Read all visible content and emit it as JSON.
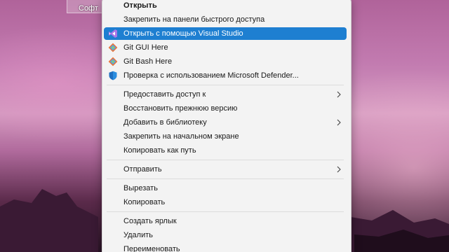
{
  "desktop": {
    "label": "Софт"
  },
  "menu": {
    "groups": [
      {
        "items": [
          {
            "label": "Открыть",
            "bold": true
          },
          {
            "label": "Закрепить на панели быстрого доступа"
          },
          {
            "label": "Открыть с помощью Visual Studio",
            "icon": "visual-studio-icon",
            "highlighted": true
          },
          {
            "label": "Git GUI Here",
            "icon": "git-gui-icon"
          },
          {
            "label": "Git Bash Here",
            "icon": "git-bash-icon"
          },
          {
            "label": "Проверка с использованием Microsoft Defender...",
            "icon": "defender-shield-icon"
          }
        ]
      },
      {
        "items": [
          {
            "label": "Предоставить доступ к",
            "submenu": true
          },
          {
            "label": "Восстановить прежнюю версию"
          },
          {
            "label": "Добавить в библиотеку",
            "submenu": true
          },
          {
            "label": "Закрепить на начальном экране"
          },
          {
            "label": "Копировать как путь"
          }
        ]
      },
      {
        "items": [
          {
            "label": "Отправить",
            "submenu": true
          }
        ]
      },
      {
        "items": [
          {
            "label": "Вырезать"
          },
          {
            "label": "Копировать"
          }
        ]
      },
      {
        "items": [
          {
            "label": "Создать ярлык"
          },
          {
            "label": "Удалить"
          },
          {
            "label": "Переименовать"
          }
        ]
      }
    ]
  },
  "colors": {
    "highlight": "#1e7fd1",
    "menu_bg": "#f3f3f3"
  }
}
